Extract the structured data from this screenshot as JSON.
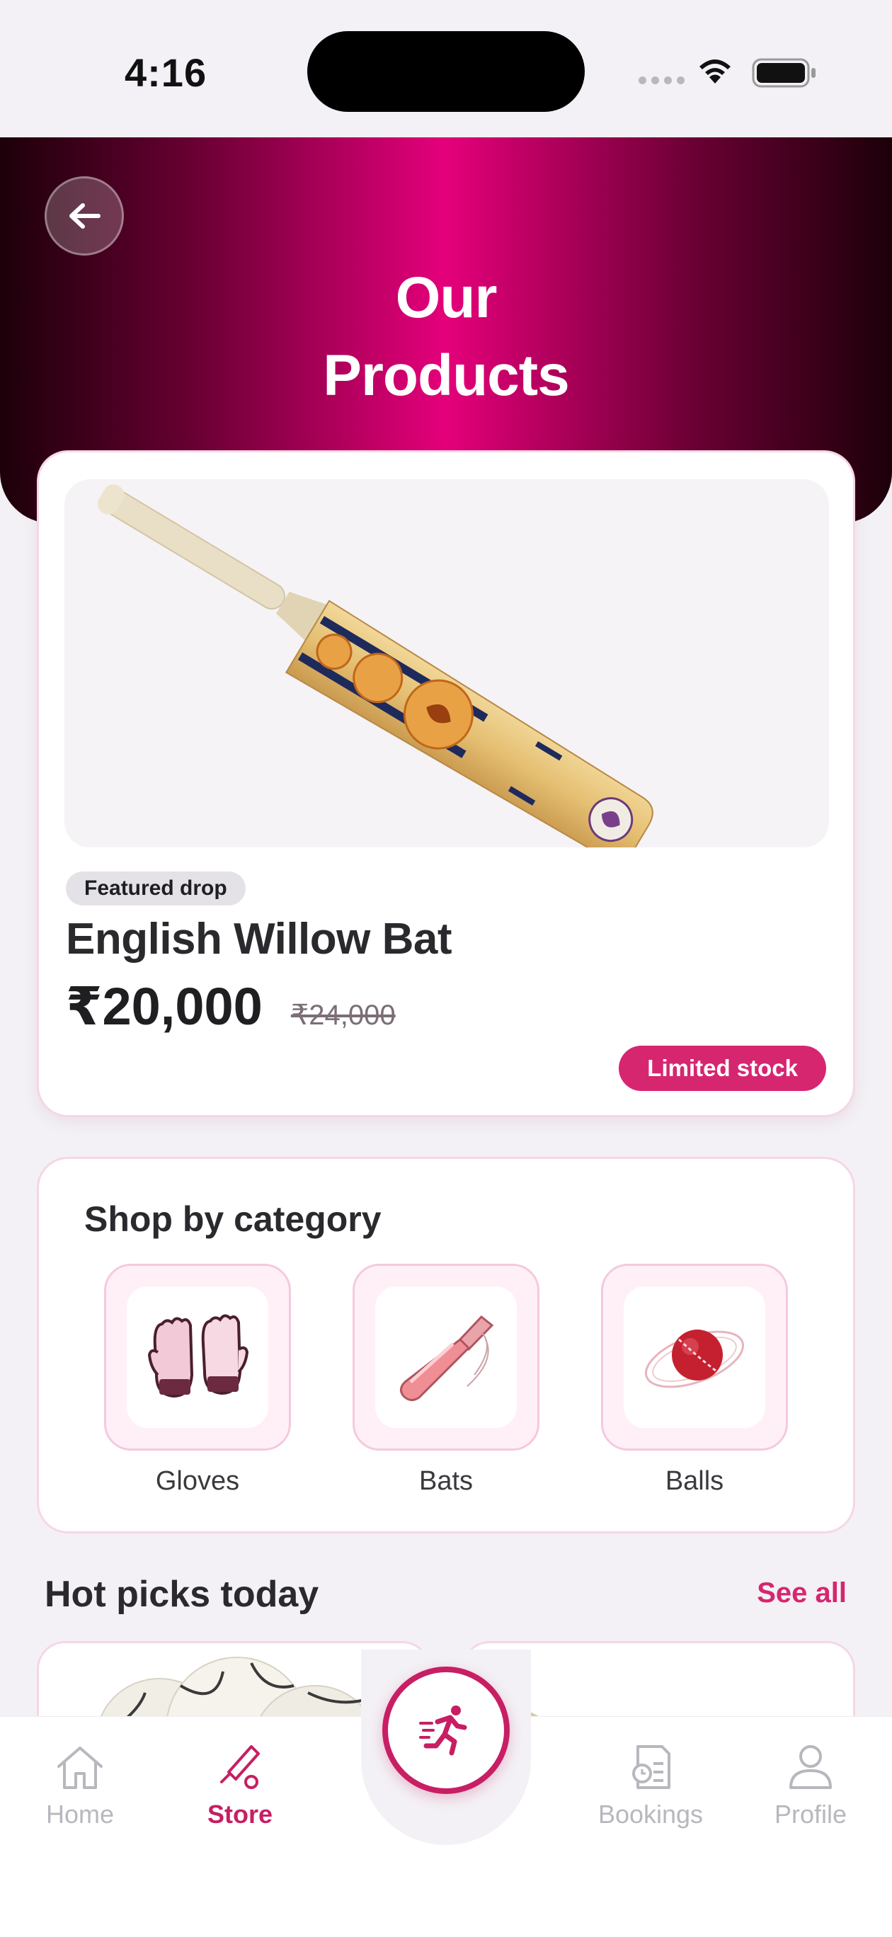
{
  "status_bar": {
    "time": "4:16"
  },
  "hero": {
    "title_line1": "Our",
    "title_line2": "Products"
  },
  "featured": {
    "badge": "Featured drop",
    "name": "English Willow Bat",
    "price": "₹20,000",
    "old_price": "₹24,000",
    "stock": "Limited stock"
  },
  "categories": {
    "title": "Shop by category",
    "items": [
      {
        "label": "Gloves",
        "icon": "gloves-icon"
      },
      {
        "label": "Bats",
        "icon": "bat-icon"
      },
      {
        "label": "Balls",
        "icon": "ball-icon"
      }
    ]
  },
  "hot_picks": {
    "title": "Hot picks today",
    "see_all": "See all"
  },
  "tabs": [
    {
      "label": "Home",
      "icon": "home-icon",
      "active": false
    },
    {
      "label": "Store",
      "icon": "bat-icon",
      "active": true
    },
    {
      "label": "Bookings",
      "icon": "bookings-icon",
      "active": false
    },
    {
      "label": "Profile",
      "icon": "profile-icon",
      "active": false
    }
  ],
  "colors": {
    "accent": "#c81e63",
    "hero_center": "#e5007b",
    "hero_edge": "#1c0009"
  }
}
